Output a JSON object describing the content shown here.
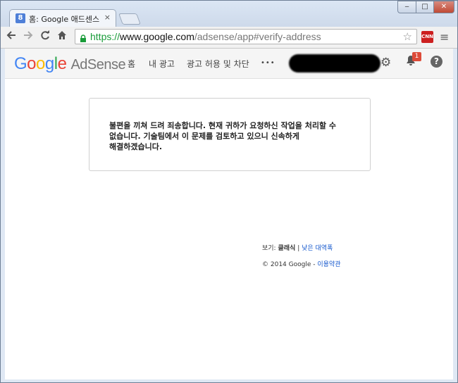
{
  "browser": {
    "tab_favicon": "8",
    "tab_title": "홈: Google 애드센스",
    "tab_close": "×",
    "url_protocol": "https://",
    "url_host": "www.google.com",
    "url_path": "/adsense/app#verify-address",
    "cnn_label": "CNN",
    "icons": [
      "back-icon",
      "forward-icon",
      "reload-icon",
      "home-icon",
      "lock-icon",
      "star-icon",
      "menu-icon"
    ]
  },
  "window_controls": {
    "minimize": "‒",
    "maximize": "□",
    "close": "✕"
  },
  "app": {
    "logo_letters": [
      "G",
      "o",
      "o",
      "g",
      "l",
      "e"
    ],
    "product": "AdSense",
    "nav": [
      "홈",
      "내 광고",
      "광고 허용 및 차단"
    ],
    "more": "•••",
    "notification_count": "1",
    "help": "?"
  },
  "error": {
    "message": "불편을 끼쳐 드려 죄송합니다. 현재 귀하가 요청하신 작업을 처리할 수 없습니다. 기술팀에서 이 문제를 검토하고 있으니 신속하게 해결하겠습니다."
  },
  "footer": {
    "view_label": "보기:",
    "view_current": "클래식",
    "separator": "|",
    "view_link": "낮은 대역폭",
    "copyright": "© 2014 Google",
    "dash": "-",
    "terms_link": "이용약관"
  },
  "colors": {
    "accent_blue": "#4285f4",
    "link": "#1155cc",
    "badge": "#dd4b39"
  }
}
